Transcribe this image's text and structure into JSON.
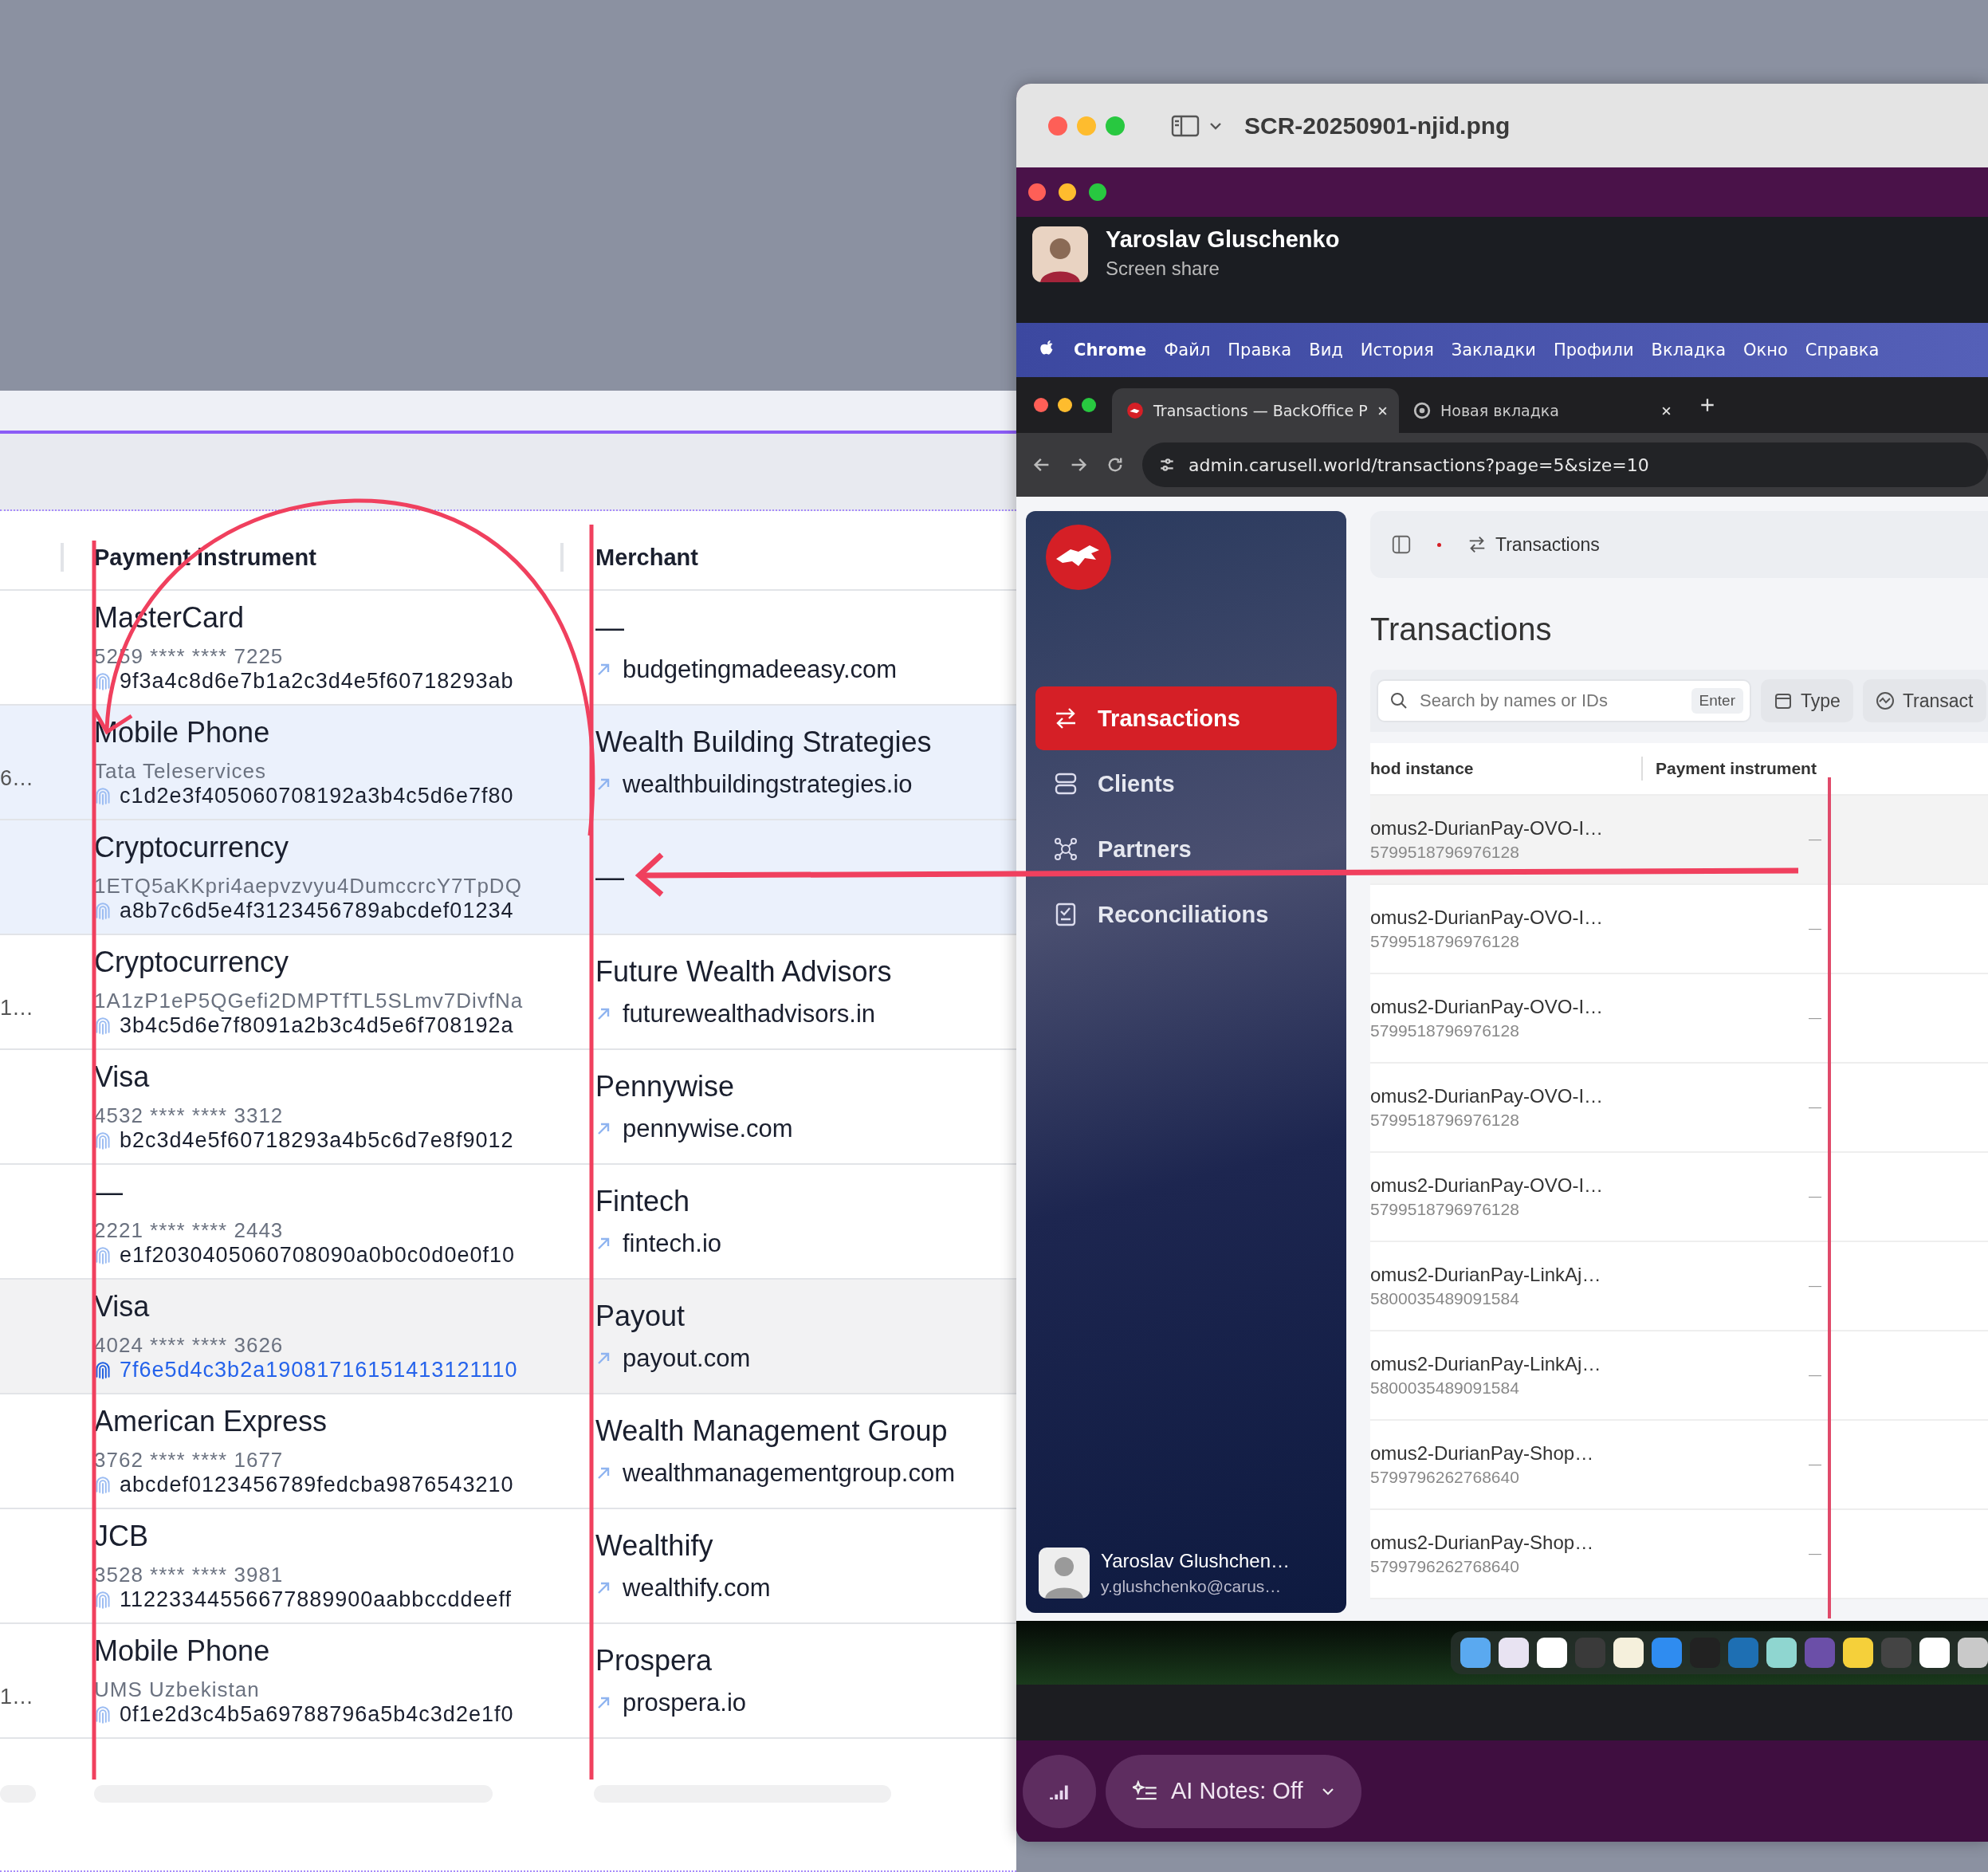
{
  "table": {
    "columns": [
      "Payment instrument",
      "Merchant"
    ],
    "rows": [
      {
        "selected": false,
        "hovered": false,
        "instrument": {
          "type": "MasterCard",
          "detail": "5259 **** **** 7225",
          "hash": "9f3a4c8d6e7b1a2c3d4e5f60718293ab"
        },
        "merchant": {
          "name": "—",
          "site": "budgetingmadeeasy.com"
        }
      },
      {
        "column_1": "6…",
        "selected": true,
        "hovered": false,
        "instrument": {
          "type": "Mobile Phone",
          "detail": "Tata Teleservices",
          "hash": "c1d2e3f405060708192a3b4c5d6e7f80"
        },
        "merchant": {
          "name": "Wealth Building Strategies",
          "site": "wealthbuildingstrategies.io"
        }
      },
      {
        "selected": true,
        "hovered": false,
        "instrument": {
          "type": "Cryptocurrency",
          "detail": "1ETQ5aKKpri4aepvzvyu4DumccrcY7TpDQ",
          "hash": "a8b7c6d5e4f3123456789abcdef01234"
        },
        "merchant": {
          "name": "—"
        }
      },
      {
        "column_1": "1…",
        "selected": false,
        "hovered": false,
        "instrument": {
          "type": "Cryptocurrency",
          "detail": "1A1zP1eP5QGefi2DMPTfTL5SLmv7DivfNa",
          "hash": "3b4c5d6e7f8091a2b3c4d5e6f708192a"
        },
        "merchant": {
          "name": "Future Wealth Advisors",
          "site": "futurewealthadvisors.in"
        }
      },
      {
        "selected": false,
        "hovered": false,
        "instrument": {
          "type": "Visa",
          "detail": "4532 **** **** 3312",
          "hash": "b2c3d4e5f60718293a4b5c6d7e8f9012"
        },
        "merchant": {
          "name": "Pennywise",
          "site": "pennywise.com"
        }
      },
      {
        "selected": false,
        "hovered": false,
        "instrument": {
          "type": "—",
          "detail": "2221 **** **** 2443",
          "hash": "e1f2030405060708090a0b0c0d0e0f10"
        },
        "merchant": {
          "name": "Fintech",
          "site": "fintech.io"
        }
      },
      {
        "selected": false,
        "hovered": true,
        "instrument": {
          "type": "Visa",
          "detail": "4024 **** **** 3626",
          "hash": "7f6e5d4c3b2a19081716151413121110"
        },
        "merchant": {
          "name": "Payout",
          "site": "payout.com"
        }
      },
      {
        "selected": false,
        "hovered": false,
        "instrument": {
          "type": "American Express",
          "detail": "3762 **** **** 1677",
          "hash": "abcdef0123456789fedcba9876543210"
        },
        "merchant": {
          "name": "Wealth Management Group",
          "site": "wealthmanagementgroup.com"
        }
      },
      {
        "selected": false,
        "hovered": false,
        "instrument": {
          "type": "JCB",
          "detail": "3528 **** **** 3981",
          "hash": "11223344556677889900aabbccddeeff"
        },
        "merchant": {
          "name": "Wealthify",
          "site": "wealthify.com"
        }
      },
      {
        "column_1": "1…",
        "selected": false,
        "hovered": false,
        "instrument": {
          "type": "Mobile Phone",
          "detail": "UMS Uzbekistan",
          "hash": "0f1e2d3c4b5a69788796a5b4c3d2e1f0"
        },
        "merchant": {
          "name": "Prospera",
          "site": "prospera.io"
        }
      }
    ]
  },
  "viewer": {
    "title": "SCR-20250901-njid.png"
  },
  "call": {
    "presenter": "Yaroslav Gluschenko",
    "subtitle": "Screen share",
    "ai_notes": "AI Notes: Off"
  },
  "menu_bar": {
    "app": "Chrome",
    "items": [
      "Файл",
      "Правка",
      "Вид",
      "История",
      "Закладки",
      "Профили",
      "Вкладка",
      "Окно",
      "Справка"
    ]
  },
  "browser": {
    "tabs": [
      {
        "title": "Transactions — BackOffice P",
        "selected": true
      },
      {
        "title": "Новая вкладка",
        "selected": false
      }
    ],
    "url": "admin.carusell.world/transactions?page=5&size=10"
  },
  "app": {
    "breadcrumb": "Transactions",
    "heading": "Transactions",
    "nav": [
      {
        "label": "Transactions",
        "selected": true
      },
      {
        "label": "Clients",
        "selected": false
      },
      {
        "label": "Partners",
        "selected": false
      },
      {
        "label": "Reconciliations",
        "selected": false
      }
    ],
    "user": {
      "name": "Yaroslav Glushchen…",
      "email": "y.glushchenko@carus…"
    },
    "search": {
      "placeholder": "Search by names or IDs",
      "key": "Enter"
    },
    "filters": [
      "Type",
      "Transact"
    ],
    "columns": [
      "hod instance",
      "Payment instrument"
    ],
    "rows": [
      {
        "method": "omus2-DurianPay-OVO-I…",
        "id": "5799518796976128",
        "instrument": "—",
        "hovered": true
      },
      {
        "method": "omus2-DurianPay-OVO-I…",
        "id": "5799518796976128",
        "instrument": "—",
        "hovered": false
      },
      {
        "method": "omus2-DurianPay-OVO-I…",
        "id": "5799518796976128",
        "instrument": "—",
        "hovered": false
      },
      {
        "method": "omus2-DurianPay-OVO-I…",
        "id": "5799518796976128",
        "instrument": "—",
        "hovered": false
      },
      {
        "method": "omus2-DurianPay-OVO-I…",
        "id": "5799518796976128",
        "instrument": "—",
        "hovered": false
      },
      {
        "method": "omus2-DurianPay-LinkAj…",
        "id": "5800035489091584",
        "instrument": "—",
        "hovered": false
      },
      {
        "method": "omus2-DurianPay-LinkAj…",
        "id": "5800035489091584",
        "instrument": "—",
        "hovered": false
      },
      {
        "method": "omus2-DurianPay-Shop…",
        "id": "5799796262768640",
        "instrument": "—",
        "hovered": false
      },
      {
        "method": "omus2-DurianPay-Shop…",
        "id": "5799796262768640",
        "instrument": "—",
        "hovered": false
      }
    ]
  }
}
